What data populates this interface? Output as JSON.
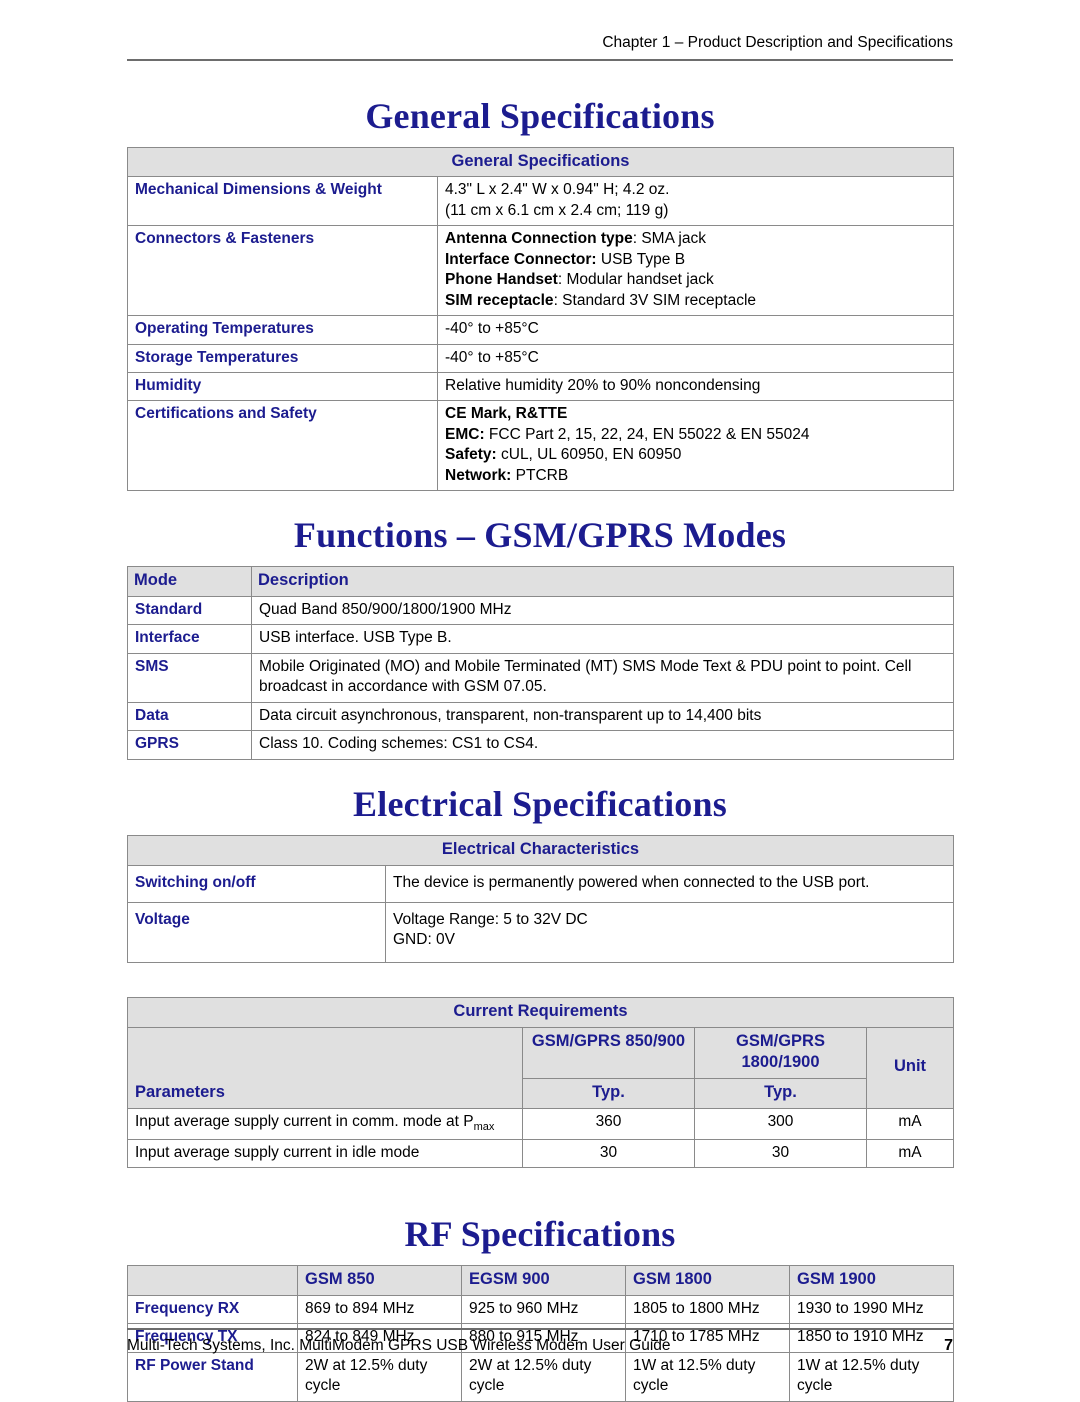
{
  "header": {
    "chapter_text": "Chapter 1 – Product Description and Specifications"
  },
  "sections": {
    "general": {
      "title": "General Specifications",
      "table": {
        "banner": "General Specifications",
        "rows": [
          {
            "label": "Mechanical Dimensions & Weight",
            "lines": [
              "4.3\" L x 2.4\" W x 0.94\" H; 4.2 oz.",
              "(11 cm x 6.1 cm x 2.4 cm; 119 g)"
            ]
          },
          {
            "label": "Connectors & Fasteners",
            "lines": [
              "Antenna Connection type: SMA jack",
              "Interface Connector: USB Type B",
              "Phone Handset: Modular handset jack",
              "SIM receptacle: Standard 3V SIM receptacle"
            ]
          },
          {
            "label": "Operating Temperatures",
            "lines": [
              "-40° to +85°C"
            ]
          },
          {
            "label": "Storage Temperatures",
            "lines": [
              "-40° to +85°C"
            ]
          },
          {
            "label": "Humidity",
            "lines": [
              "Relative humidity 20% to 90% noncondensing"
            ]
          },
          {
            "label": "Certifications and Safety",
            "lines": [
              "CE Mark, R&TTE",
              "EMC: FCC Part 2, 15, 22, 24, EN 55022 & EN 55024",
              "Safety: cUL, UL 60950, EN 60950",
              "Network: PTCRB"
            ]
          }
        ],
        "cell_text": {
          "mech_l1": "4.3\" L x 2.4\" W x 0.94\" H; 4.2 oz.",
          "mech_l2": "(11 cm x 6.1 cm x 2.4 cm; 119 g)",
          "conn_l1_b": "Antenna Connection type",
          "conn_l1_r": ": SMA jack",
          "conn_l2_b": "Interface Connector:",
          "conn_l2_r": " USB Type B",
          "conn_l3_b": "Phone Handset",
          "conn_l3_r": ": Modular handset jack",
          "conn_l4_b": "SIM receptacle",
          "conn_l4_r": ": Standard 3V SIM receptacle",
          "op_temp": "-40° to +85°C",
          "st_temp": "-40° to +85°C",
          "humidity": "Relative humidity 20% to 90% noncondensing",
          "cert_l1_b": "CE Mark, R&TTE",
          "cert_l2_b": "EMC:",
          "cert_l2_r": " FCC Part 2, 15, 22, 24, EN 55022 & EN 55024",
          "cert_l3_b": "Safety:",
          "cert_l3_r": " cUL, UL 60950, EN 60950",
          "cert_l4_b": "Network:",
          "cert_l4_r": " PTCRB"
        },
        "labels": {
          "mech": "Mechanical Dimensions & Weight",
          "conn": "Connectors & Fasteners",
          "op_temp": "Operating Temperatures",
          "st_temp": "Storage Temperatures",
          "humidity": "Humidity",
          "cert": "Certifications and Safety"
        }
      }
    },
    "functions": {
      "title": "Functions – GSM/GPRS Modes",
      "table": {
        "headers": {
          "mode": "Mode",
          "description": "Description"
        },
        "rows": [
          {
            "mode": "Standard",
            "description": "Quad Band 850/900/1800/1900 MHz"
          },
          {
            "mode": "Interface",
            "description": "USB interface. USB Type B."
          },
          {
            "mode": "SMS",
            "description": "Mobile Originated (MO) and Mobile Terminated (MT) SMS Mode Text & PDU point to point. Cell broadcast in accordance with GSM 07.05."
          },
          {
            "mode": "Data",
            "description": "Data circuit asynchronous, transparent, non-transparent up to 14,400 bits"
          },
          {
            "mode": "GPRS",
            "description": "Class 10.  Coding schemes: CS1 to CS4."
          }
        ]
      }
    },
    "electrical": {
      "title": "Electrical Specifications",
      "table": {
        "banner": "Electrical Characteristics",
        "rows": [
          {
            "label": "Switching on/off",
            "lines": [
              "The device is permanently powered when connected to the USB port."
            ]
          },
          {
            "label": "Voltage",
            "lines": [
              "Voltage Range: 5 to 32V DC",
              "GND: 0V"
            ]
          }
        ],
        "labels": {
          "switching": "Switching on/off",
          "voltage": "Voltage"
        },
        "values": {
          "switching": "The device is permanently powered when connected to the USB port.",
          "voltage_l1": "Voltage Range: 5 to 32V DC",
          "voltage_l2": "GND: 0V"
        }
      },
      "current_table": {
        "banner": "Current Requirements",
        "headers": {
          "parameters": "Parameters",
          "band_a": "GSM/GPRS 850/900",
          "band_b": "GSM/GPRS 1800/1900",
          "unit": "Unit",
          "typ_a": "Typ.",
          "typ_b": "Typ."
        },
        "rows": [
          {
            "parameter_main": "Input average supply current in comm. mode at P",
            "parameter_sub": "max",
            "band_a": "360",
            "band_b": "300",
            "unit": "mA"
          },
          {
            "parameter_main": "Input average supply current in idle mode",
            "parameter_sub": "",
            "band_a": "30",
            "band_b": "30",
            "unit": "mA"
          }
        ]
      }
    },
    "rf": {
      "title": "RF Specifications",
      "table": {
        "headers": {
          "blank": "",
          "gsm850": "GSM 850",
          "egsm900": "EGSM 900",
          "gsm1800": "GSM 1800",
          "gsm1900": "GSM 1900"
        },
        "rows": [
          {
            "label": "Frequency RX",
            "gsm850": "869 to 894 MHz",
            "egsm900": "925 to 960 MHz",
            "gsm1800": "1805 to 1800 MHz",
            "gsm1900": "1930 to 1990 MHz"
          },
          {
            "label": "Frequency TX",
            "gsm850": "824 to 849 MHz",
            "egsm900": "880 to 915 MHz",
            "gsm1800": "1710 to 1785 MHz",
            "gsm1900": "1850 to 1910 MHz"
          },
          {
            "label": "RF Power Stand",
            "gsm850": "2W at 12.5% duty cycle",
            "egsm900": "2W at 12.5% duty cycle",
            "gsm1800": "1W at 12.5% duty cycle",
            "gsm1900": "1W at 12.5% duty cycle"
          }
        ]
      }
    }
  },
  "footer": {
    "text": "Multi-Tech Systems, Inc. MultiModem GPRS USB Wireless Modem User Guide",
    "page_number": "7"
  },
  "colors": {
    "heading_blue": "#1c1c8f",
    "band_gray": "#e0e0e0",
    "rule_gray": "#6d6d6d"
  }
}
